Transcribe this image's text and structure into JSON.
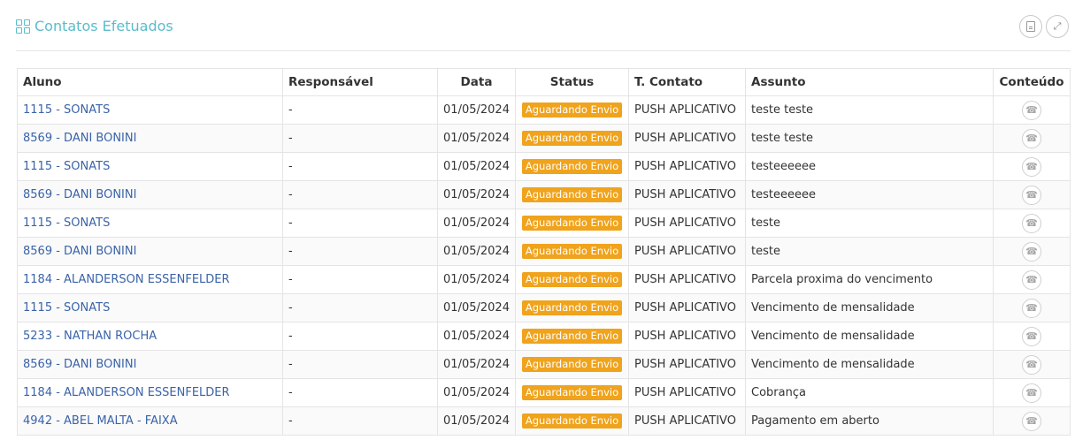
{
  "header": {
    "title": "Contatos Efetuados",
    "icons": {
      "title": "grid-icon",
      "export": "document-icon",
      "expand": "expand-icon"
    }
  },
  "table": {
    "columns": [
      "Aluno",
      "Responsável",
      "Data",
      "Status",
      "T. Contato",
      "Assunto",
      "Conteúdo"
    ],
    "rows": [
      {
        "aluno": "1115 - SONATS",
        "responsavel": "-",
        "data": "01/05/2024",
        "status": "Aguardando Envio",
        "tipo": "PUSH APLICATIVO",
        "assunto": "teste teste"
      },
      {
        "aluno": "8569 - DANI BONINI",
        "responsavel": "-",
        "data": "01/05/2024",
        "status": "Aguardando Envio",
        "tipo": "PUSH APLICATIVO",
        "assunto": "teste teste"
      },
      {
        "aluno": "1115 - SONATS",
        "responsavel": "-",
        "data": "01/05/2024",
        "status": "Aguardando Envio",
        "tipo": "PUSH APLICATIVO",
        "assunto": "testeeeeee"
      },
      {
        "aluno": "8569 - DANI BONINI",
        "responsavel": "-",
        "data": "01/05/2024",
        "status": "Aguardando Envio",
        "tipo": "PUSH APLICATIVO",
        "assunto": "testeeeeee"
      },
      {
        "aluno": "1115 - SONATS",
        "responsavel": "-",
        "data": "01/05/2024",
        "status": "Aguardando Envio",
        "tipo": "PUSH APLICATIVO",
        "assunto": "teste"
      },
      {
        "aluno": "8569 - DANI BONINI",
        "responsavel": "-",
        "data": "01/05/2024",
        "status": "Aguardando Envio",
        "tipo": "PUSH APLICATIVO",
        "assunto": "teste"
      },
      {
        "aluno": "1184 - ALANDERSON ESSENFELDER",
        "responsavel": "-",
        "data": "01/05/2024",
        "status": "Aguardando Envio",
        "tipo": "PUSH APLICATIVO",
        "assunto": "Parcela proxima do vencimento"
      },
      {
        "aluno": "1115 - SONATS",
        "responsavel": "-",
        "data": "01/05/2024",
        "status": "Aguardando Envio",
        "tipo": "PUSH APLICATIVO",
        "assunto": "Vencimento de mensalidade"
      },
      {
        "aluno": "5233 - NATHAN ROCHA",
        "responsavel": "-",
        "data": "01/05/2024",
        "status": "Aguardando Envio",
        "tipo": "PUSH APLICATIVO",
        "assunto": "Vencimento de mensalidade"
      },
      {
        "aluno": "8569 - DANI BONINI",
        "responsavel": "-",
        "data": "01/05/2024",
        "status": "Aguardando Envio",
        "tipo": "PUSH APLICATIVO",
        "assunto": "Vencimento de mensalidade"
      },
      {
        "aluno": "1184 - ALANDERSON ESSENFELDER",
        "responsavel": "-",
        "data": "01/05/2024",
        "status": "Aguardando Envio",
        "tipo": "PUSH APLICATIVO",
        "assunto": "Cobrança"
      },
      {
        "aluno": "4942 - ABEL MALTA - FAIXA",
        "responsavel": "-",
        "data": "01/05/2024",
        "status": "Aguardando Envio",
        "tipo": "PUSH APLICATIVO",
        "assunto": "Pagamento em aberto"
      }
    ],
    "content_icon": "phone-icon"
  },
  "colors": {
    "title": "#5bbccb",
    "link": "#3a63a8",
    "badge": "#f0a31c"
  }
}
